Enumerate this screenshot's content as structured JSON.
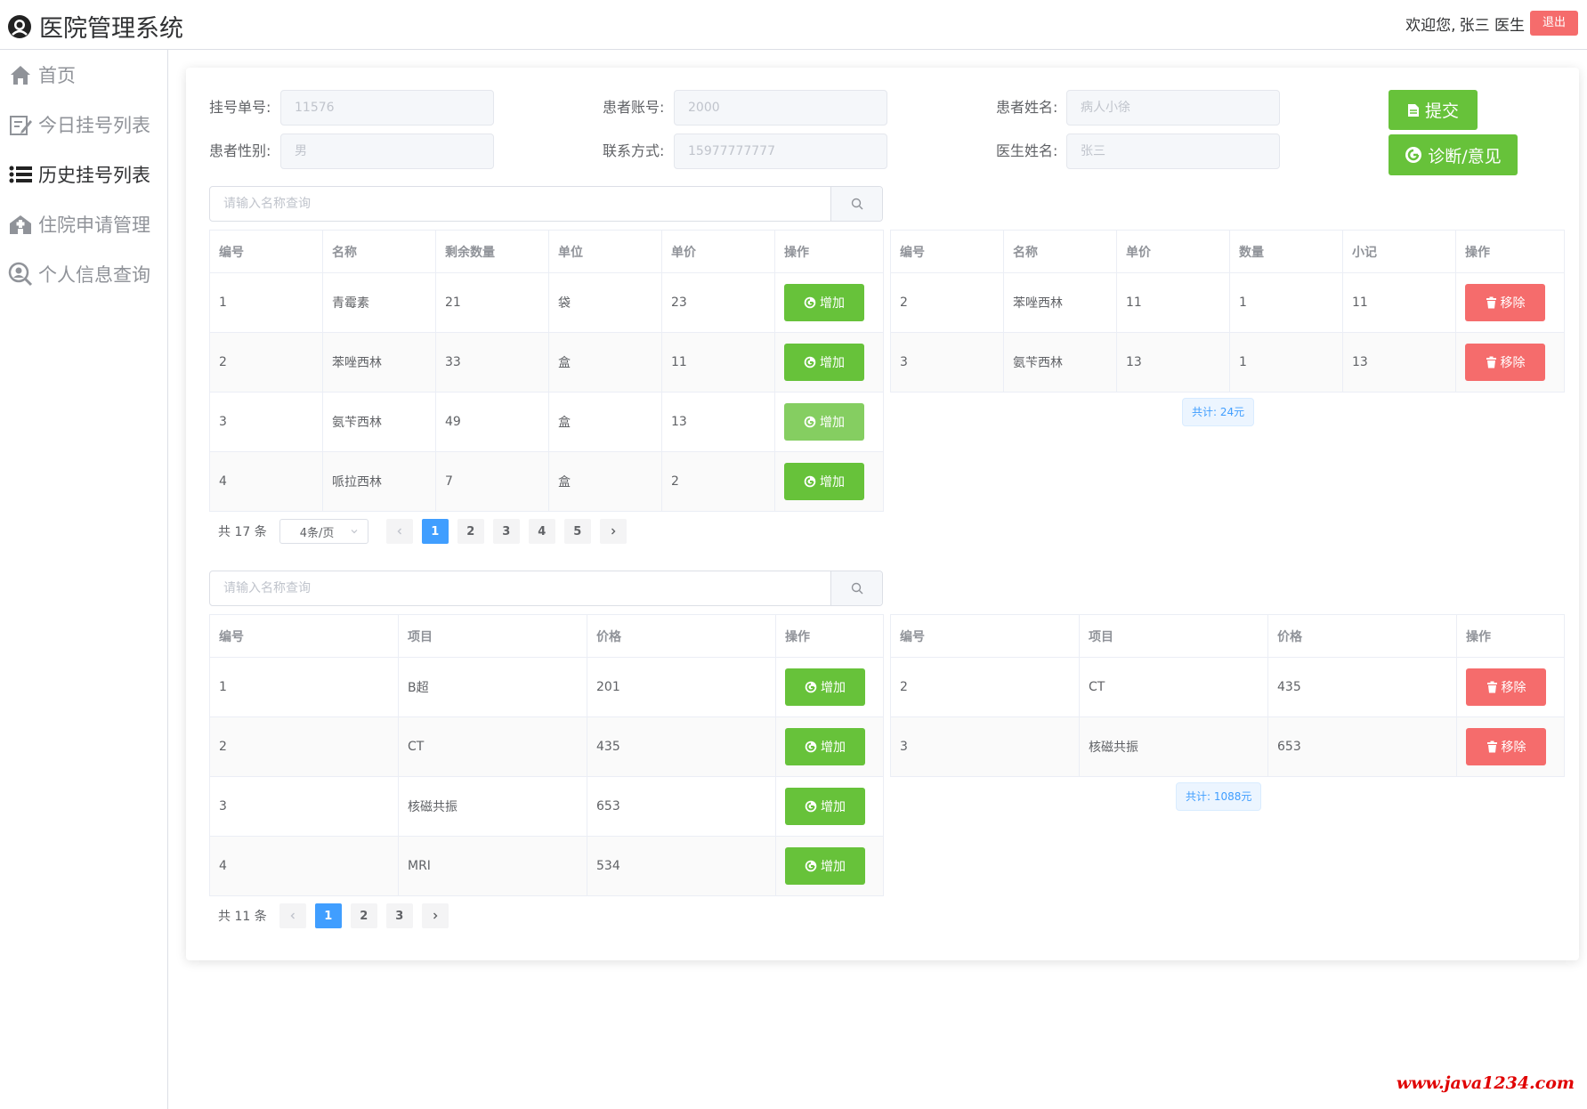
{
  "header": {
    "title": "医院管理系统",
    "welcome": "欢迎您,",
    "user": "张三 医生",
    "logout": "退出"
  },
  "sidebar": {
    "items": [
      {
        "label": "首页"
      },
      {
        "label": "今日挂号列表"
      },
      {
        "label": "历史挂号列表"
      },
      {
        "label": "住院申请管理"
      },
      {
        "label": "个人信息查询"
      }
    ]
  },
  "form": {
    "reg_no_label": "挂号单号:",
    "reg_no": "11576",
    "account_label": "患者账号:",
    "account": "2000",
    "patient_name_label": "患者姓名:",
    "patient_name": "病人小徐",
    "gender_label": "患者性别:",
    "gender": "男",
    "phone_label": "联系方式:",
    "phone": "15977777777",
    "doctor_label": "医生姓名:",
    "doctor": "张三",
    "submit": "提交",
    "diagnose": "诊断/意见"
  },
  "drug_search": {
    "placeholder": "请输入名称查询"
  },
  "drug_table": {
    "headers": [
      "编号",
      "名称",
      "剩余数量",
      "单位",
      "单价",
      "操作"
    ],
    "add_label": "增加",
    "rows": [
      [
        "1",
        "青霉素",
        "21",
        "袋",
        "23"
      ],
      [
        "2",
        "苯唑西林",
        "33",
        "盒",
        "11"
      ],
      [
        "3",
        "氨苄西林",
        "49",
        "盒",
        "13"
      ],
      [
        "4",
        "哌拉西林",
        "7",
        "盒",
        "2"
      ]
    ]
  },
  "drug_pager": {
    "total": "共 17 条",
    "page_size": "4条/页",
    "pages": [
      "1",
      "2",
      "3",
      "4",
      "5"
    ],
    "current": "1"
  },
  "drug_selected": {
    "headers": [
      "编号",
      "名称",
      "单价",
      "数量",
      "小记",
      "操作"
    ],
    "remove_label": "移除",
    "rows": [
      [
        "2",
        "苯唑西林",
        "11",
        "1",
        "11"
      ],
      [
        "3",
        "氨苄西林",
        "13",
        "1",
        "13"
      ]
    ],
    "total": "共计: 24元"
  },
  "item_search": {
    "placeholder": "请输入名称查询"
  },
  "item_table": {
    "headers": [
      "编号",
      "项目",
      "价格",
      "操作"
    ],
    "add_label": "增加",
    "rows": [
      [
        "1",
        "B超",
        "201"
      ],
      [
        "2",
        "CT",
        "435"
      ],
      [
        "3",
        "核磁共振",
        "653"
      ],
      [
        "4",
        "MRI",
        "534"
      ]
    ]
  },
  "item_pager": {
    "total": "共 11 条",
    "pages": [
      "1",
      "2",
      "3"
    ],
    "current": "1"
  },
  "item_selected": {
    "headers": [
      "编号",
      "项目",
      "价格",
      "操作"
    ],
    "remove_label": "移除",
    "rows": [
      [
        "2",
        "CT",
        "435"
      ],
      [
        "3",
        "核磁共振",
        "653"
      ]
    ],
    "total": "共计: 1088元"
  },
  "watermark": "www.java1234.com",
  "colors": {
    "primary": "#409eff",
    "success": "#67c23a",
    "danger": "#f56c6c"
  }
}
